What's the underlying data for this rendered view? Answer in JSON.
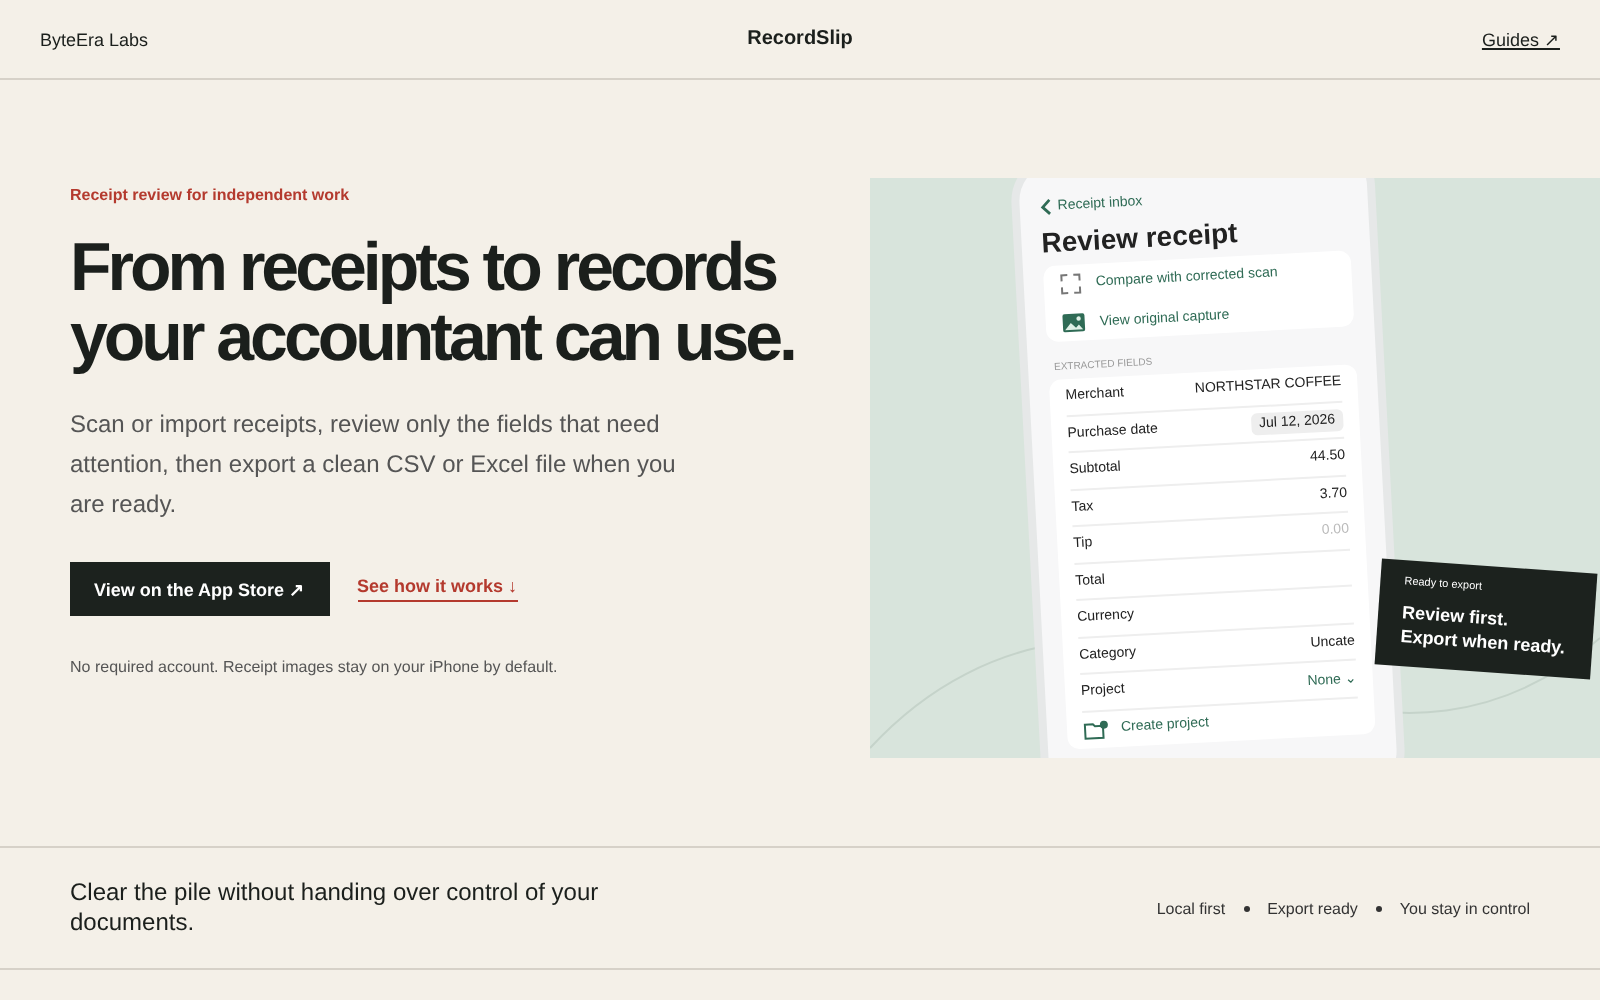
{
  "header": {
    "brand": "ByteEra Labs",
    "product": "RecordSlip",
    "link": "Guides ↗"
  },
  "hero": {
    "eyebrow": "Receipt review for independent work",
    "headline": "From receipts to records your accountant can use.",
    "body": "Scan or import receipts, review only the fields that need attention, then export a clean CSV or Excel file when you are ready.",
    "primary_button": "View on the App Store ↗",
    "secondary_link": "See how it works ↓",
    "note": "No required account. Receipt images stay on your iPhone by default."
  },
  "phone": {
    "back_link": "Receipt inbox",
    "title": "Review receipt",
    "actions": [
      {
        "kind": "scan",
        "label": "Compare with corrected scan"
      },
      {
        "kind": "image",
        "label": "View original capture"
      }
    ],
    "section_label": "EXTRACTED FIELDS",
    "fields": [
      {
        "label": "Merchant",
        "value": "NORTHSTAR COFFEE",
        "kind": "text"
      },
      {
        "label": "Purchase date",
        "value": "Jul 12, 2026",
        "kind": "chip"
      },
      {
        "label": "Subtotal",
        "value": "44.50",
        "kind": "text"
      },
      {
        "label": "Tax",
        "value": "3.70",
        "kind": "text"
      },
      {
        "label": "Tip",
        "placeholder": "0.00",
        "kind": "input"
      },
      {
        "label": "Total"
      },
      {
        "label": "Currency"
      },
      {
        "label": "Category",
        "value": "Uncate",
        "kind": "text"
      },
      {
        "label": "Project",
        "value": "None ⌄",
        "kind": "menu"
      }
    ],
    "create_label": "Create project"
  },
  "badge": {
    "eyebrow": "Ready to export",
    "lines": [
      "Review first.",
      "Export when ready."
    ]
  },
  "footer": {
    "tagline": "Clear the pile without handing over control of your documents.",
    "points": [
      "Local first",
      "Export ready",
      "You stay in control"
    ]
  }
}
